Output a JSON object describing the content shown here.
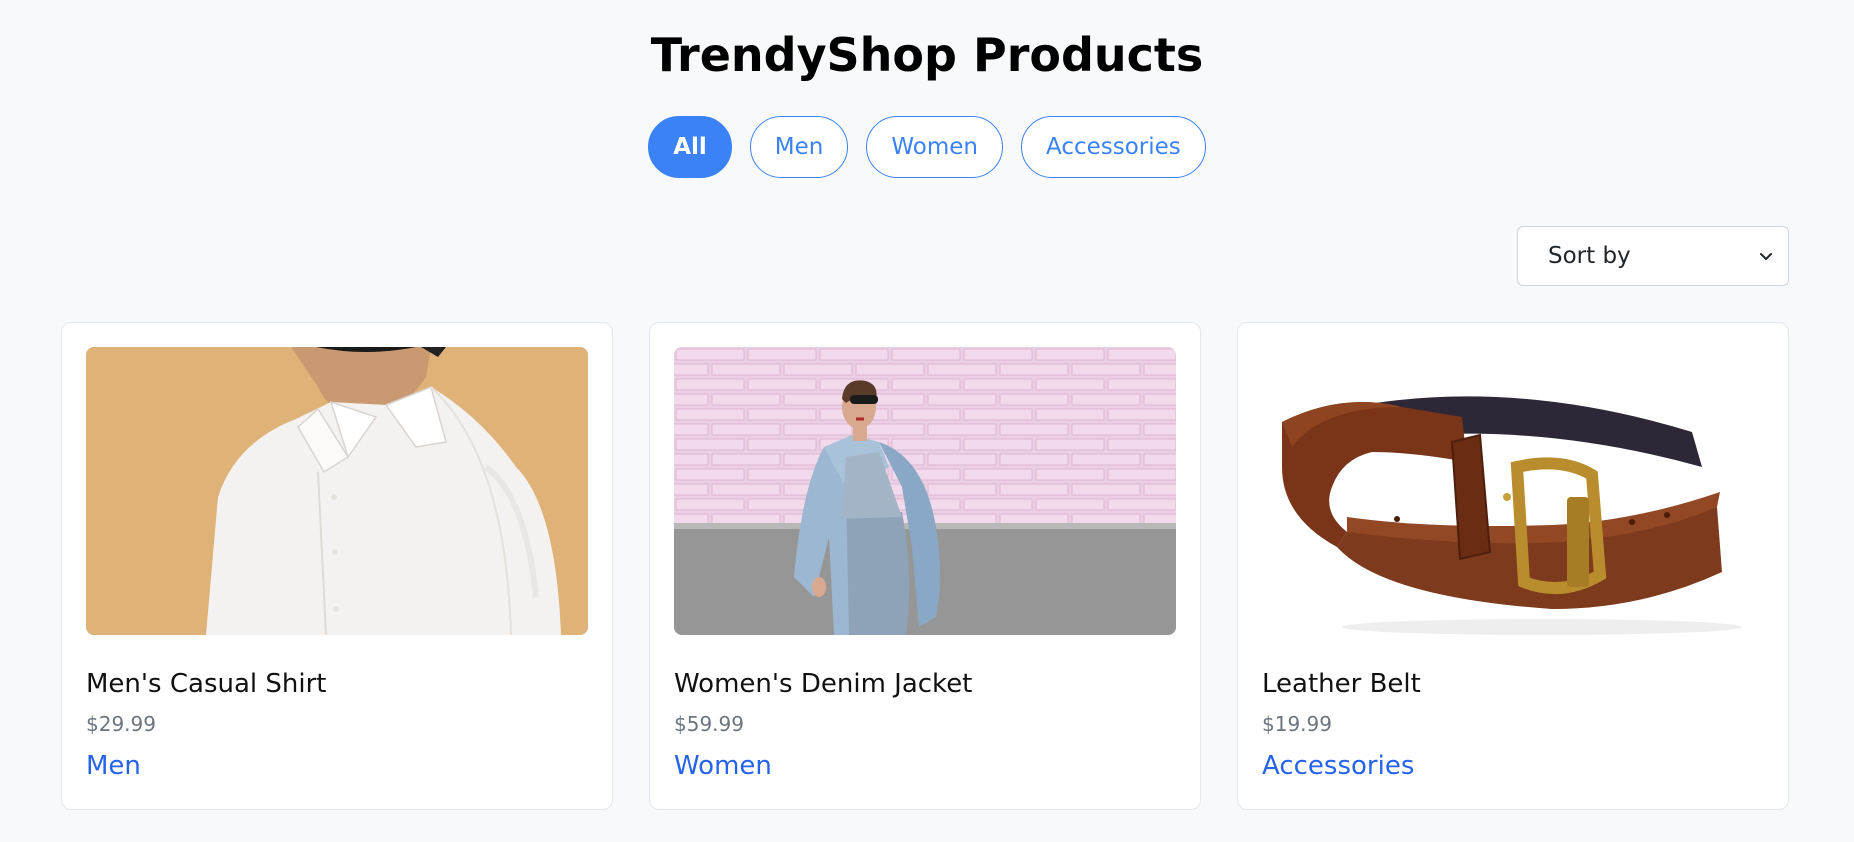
{
  "page": {
    "title": "TrendyShop Products"
  },
  "filters": [
    {
      "label": "All",
      "active": true
    },
    {
      "label": "Men",
      "active": false
    },
    {
      "label": "Women",
      "active": false
    },
    {
      "label": "Accessories",
      "active": false
    }
  ],
  "sort": {
    "selected": "Sort by",
    "icon": "chevron-down-icon"
  },
  "products": [
    {
      "name": "Men's Casual Shirt",
      "price": "$29.99",
      "category": "Men",
      "image": "white-shirt-photo"
    },
    {
      "name": "Women's Denim Jacket",
      "price": "$59.99",
      "category": "Women",
      "image": "denim-jacket-photo"
    },
    {
      "name": "Leather Belt",
      "price": "$19.99",
      "category": "Accessories",
      "image": "leather-belt-photo"
    }
  ],
  "colors": {
    "accent": "#3b82f6",
    "link": "#2563eb",
    "background": "#f8f9fa",
    "price": "#6c757d"
  }
}
